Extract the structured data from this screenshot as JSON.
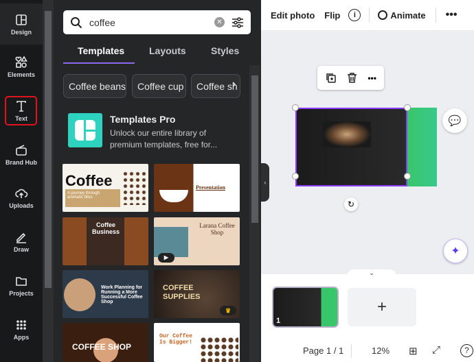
{
  "sidebar": {
    "items": [
      {
        "label": "Design",
        "icon": "layout-icon"
      },
      {
        "label": "Elements",
        "icon": "shapes-icon"
      },
      {
        "label": "Text",
        "icon": "text-icon"
      },
      {
        "label": "Brand Hub",
        "icon": "brand-icon"
      },
      {
        "label": "Uploads",
        "icon": "cloud-upload-icon"
      },
      {
        "label": "Draw",
        "icon": "pen-icon"
      },
      {
        "label": "Projects",
        "icon": "folder-icon"
      },
      {
        "label": "Apps",
        "icon": "grid-icon"
      }
    ],
    "highlight_color": "#e0141e"
  },
  "search": {
    "value": "coffee"
  },
  "tabs": [
    {
      "label": "Templates",
      "active": true
    },
    {
      "label": "Layouts"
    },
    {
      "label": "Styles"
    }
  ],
  "chips": [
    "Coffee beans",
    "Coffee cup",
    "Coffee sh"
  ],
  "promo": {
    "title": "Templates Pro",
    "description": "Unlock our entire library of premium templates, free for..."
  },
  "templates": [
    {
      "text": "Coffee",
      "sub": "A journey through aromatic bliss"
    },
    {
      "text": "Presentation"
    },
    {
      "text": "Coffee Business"
    },
    {
      "text": "Larana Coffee Shop"
    },
    {
      "text": "Work Planning for Running a More Successful Coffee Shop"
    },
    {
      "text": "COFFEE SUPPLIES"
    },
    {
      "text": "COFFEE SHOP"
    },
    {
      "text": "Our Coffee Is Bigger!"
    }
  ],
  "toolbar": {
    "edit_photo": "Edit photo",
    "flip": "Flip",
    "animate": "Animate"
  },
  "pages": {
    "thumb_number": "1",
    "add": "+"
  },
  "footer": {
    "page": "Page 1 / 1",
    "zoom": "12%"
  }
}
